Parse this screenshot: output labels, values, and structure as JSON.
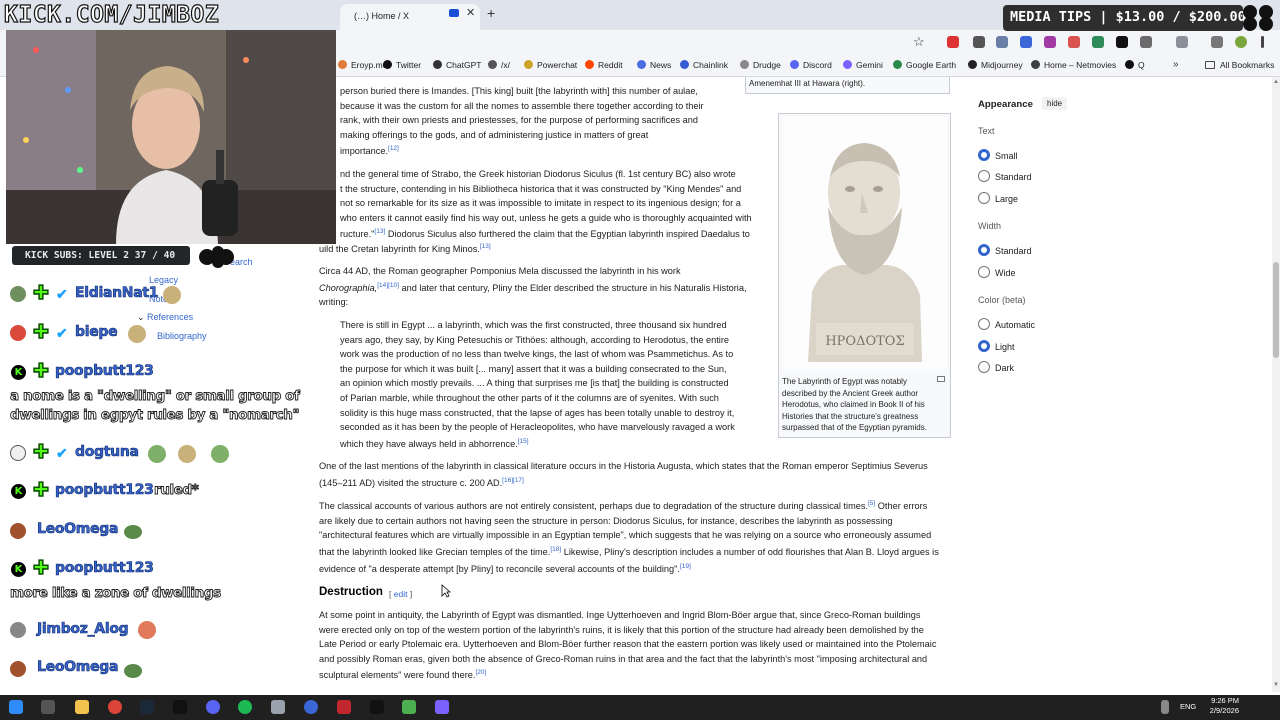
{
  "browser": {
    "tab_title": "(…) Home / X",
    "bookmarks": [
      {
        "label": "Eroyp.me",
        "color": "#e07b39"
      },
      {
        "label": "Twitter",
        "color": "#111111"
      },
      {
        "label": "ChatGPT",
        "color": "#333333"
      },
      {
        "label": "/x/",
        "color": "#555555"
      },
      {
        "label": "Powerchat",
        "color": "#c9a227"
      },
      {
        "label": "Reddit",
        "color": "#ff4500"
      },
      {
        "label": "News",
        "color": "#4a6ee0"
      },
      {
        "label": "Chainlink",
        "color": "#375bd2"
      },
      {
        "label": "Drudge",
        "color": "#888888"
      },
      {
        "label": "Discord",
        "color": "#5865f2"
      },
      {
        "label": "Gemini",
        "color": "#7b61ff"
      },
      {
        "label": "Google Earth",
        "color": "#2a8a4a"
      },
      {
        "label": "Midjourney",
        "color": "#222222"
      },
      {
        "label": "Home – Netmovies",
        "color": "#3c4043"
      },
      {
        "label": "Q",
        "color": "#111111"
      }
    ],
    "all_bookmarks": "All Bookmarks"
  },
  "overlays": {
    "channel": "KICK.COM/JIMBOZ",
    "media_tips": "MEDIA TIPS | $13.00 / $200.00",
    "kick_subs": "KICK SUBS: LEVEL 2 37 / 40"
  },
  "chat": [
    {
      "user": "EldianNat1",
      "badges": [
        "plus",
        "check"
      ],
      "avatar": "#6f8f5e",
      "message": ""
    },
    {
      "user": "biepe",
      "badges": [
        "plus",
        "check"
      ],
      "avatar": "#d94a3a",
      "message": ""
    },
    {
      "user": "poopbutt123",
      "badges": [
        "k",
        "plus"
      ],
      "avatar": "",
      "message": "a nome is a \"dwelling\" or small group of\ndwellings in egpyt rules by a \"nomarch\""
    },
    {
      "user": "dogtuna",
      "badges": [
        "plus",
        "check"
      ],
      "avatar": "#f0f0f0",
      "message": ""
    },
    {
      "user": "poopbutt123",
      "badges": [
        "k",
        "plus"
      ],
      "avatar": "",
      "message": "ruled*"
    },
    {
      "user": "LeoOmega",
      "badges": [],
      "avatar": "#a0522d",
      "message": ""
    },
    {
      "user": "poopbutt123",
      "badges": [
        "k",
        "plus"
      ],
      "avatar": "",
      "message": "more like a zone of dwellings"
    },
    {
      "user": "Jimboz_Alog",
      "badges": [],
      "avatar": "#888888",
      "message": ""
    },
    {
      "user": "LeoOmega",
      "badges": [],
      "avatar": "#a0522d",
      "message": ""
    }
  ],
  "toc": {
    "search": "earch",
    "legacy": "Legacy",
    "notes": "Notes",
    "references": "References",
    "bibliography": "Bibliography"
  },
  "article": {
    "caption_top": "Amenemhat III at Hawara (right).",
    "para1": [
      "person buried there is Imandes. [This king] built [the labyrinth with] this number of aulae,",
      "because it was the custom for all the nomes to assemble there together according to their",
      "rank, with their own priests and priestesses, for the purpose of performing sacrifices and",
      "making offerings to the gods, and of administering justice in matters of great",
      "importance."
    ],
    "para1_ref": "[12]",
    "para2": [
      "nd the general time of Strabo, the Greek historian Diodorus Siculus (fl. 1st century BC) also wrote",
      "t the structure, contending in his Bibliotheca historica that it was constructed by \"King Mendes\" and",
      "not so remarkable for its size as it was impossible to imitate in respect to its ingenious design; for a",
      "who enters it cannot easily find his way out, unless he gets a guide who is thoroughly acquainted with",
      "ructure.\"",
      " Diodorus Siculus also furthered the claim that the Egyptian labyrinth inspired Daedalus to",
      "uild the Cretan labyrinth for King Minos."
    ],
    "para2_refs": [
      "[13]",
      "[13]"
    ],
    "para3": [
      "Circa 44 AD, the Roman geographer Pomponius Mela discussed the labyrinth in his work",
      "Chorographia,",
      " and later that century, Pliny the Elder described the structure in his Naturalis Historia,",
      "writing:"
    ],
    "para3_refs": [
      "[14][10]"
    ],
    "quote": [
      "There is still in Egypt ... a labyrinth, which was the first constructed, three thousand six hundred",
      "years ago, they say, by King Petesuchis or Tithöes: although, according to Herodotus, the entire",
      "work was the production of no less than twelve kings, the last of whom was Psammetichus. As to",
      "the purpose for which it was built [... many] assert that it was a building consecrated to the Sun,",
      "an opinion which mostly prevails. ... A thing that surprises me [is that] the building is constructed",
      "of Parian marble, while throughout the other parts of it the columns are of syenites. With such",
      "solidity is this huge mass constructed, that the lapse of ages has been totally unable to destroy it,",
      "seconded as it has been by the people of Heracleopolites, who have marvelously ravaged a work",
      "which they have always held in abhorrence."
    ],
    "quote_ref": "[15]",
    "para4": [
      "One of the last mentions of the labyrinth in classical literature occurs in the Historia Augusta, which states that the Roman emperor Septimius Severus",
      "(145–211 AD) visited the structure c. 200 AD."
    ],
    "para4_ref": "[16][17]",
    "para5": [
      "The classical accounts of various authors are not entirely consistent, perhaps due to degradation of the structure during classical times.",
      " Other errors",
      "are likely due to certain authors not having seen the structure in person: Diodorus Siculus, for instance, describes the labyrinth as possessing",
      "\"architectural features which are virtually impossible in an Egyptian temple\", which suggests that he was relying on a source who erroneously assumed",
      "that the labyrinth looked like Grecian temples of the time.",
      " Likewise, Pliny's description includes a number of odd flourishes that Alan B. Lloyd argues is",
      "evidence of \"a desperate attempt [by Pliny] to reconcile several accounts of the building\"."
    ],
    "para5_refs": [
      "[5]",
      "[18]",
      "[19]"
    ],
    "heading": "Destruction",
    "edit": "edit",
    "para6": [
      "At some point in antiquity, the Labyrinth of Egypt was dismantled. Inge Uytterhoeven and Ingrid Blom-Böer argue that, since Greco-Roman buildings",
      "were erected only on top of the western portion of the labyrinth's ruins, it is likely that this portion of the structure had already been demolished by the",
      "Late Period or early Ptolemaic era. Uytterhoeven and Blom-Böer further reason that the eastern portion was likely used or maintained into the Ptolemaic",
      "and possibly Roman eras, given both the absence of Greco-Roman ruins in that area and the fact that the labyrinth's most \"imposing architectural and",
      "sculptural elements\" were found there."
    ],
    "para6_ref": "[20]",
    "figure_caption": "The Labyrinth of Egypt was notably described by the Ancient Greek author Herodotus, who claimed in Book II of his Histories that the structure's greatness surpassed that of the Egyptian pyramids.",
    "bust_inscription": "ΗΡΟΔΟΤΟΣ"
  },
  "appearance": {
    "title": "Appearance",
    "hide": "hide",
    "text_label": "Text",
    "text_options": [
      "Small",
      "Standard",
      "Large"
    ],
    "text_selected": "Small",
    "width_label": "Width",
    "width_options": [
      "Standard",
      "Wide"
    ],
    "width_selected": "Standard",
    "color_label": "Color (beta)",
    "color_options": [
      "Automatic",
      "Light",
      "Dark"
    ],
    "color_selected": "Light"
  },
  "taskbar": {
    "lang": "ENG",
    "time": "9:26 PM",
    "date": "2/9/2026"
  }
}
